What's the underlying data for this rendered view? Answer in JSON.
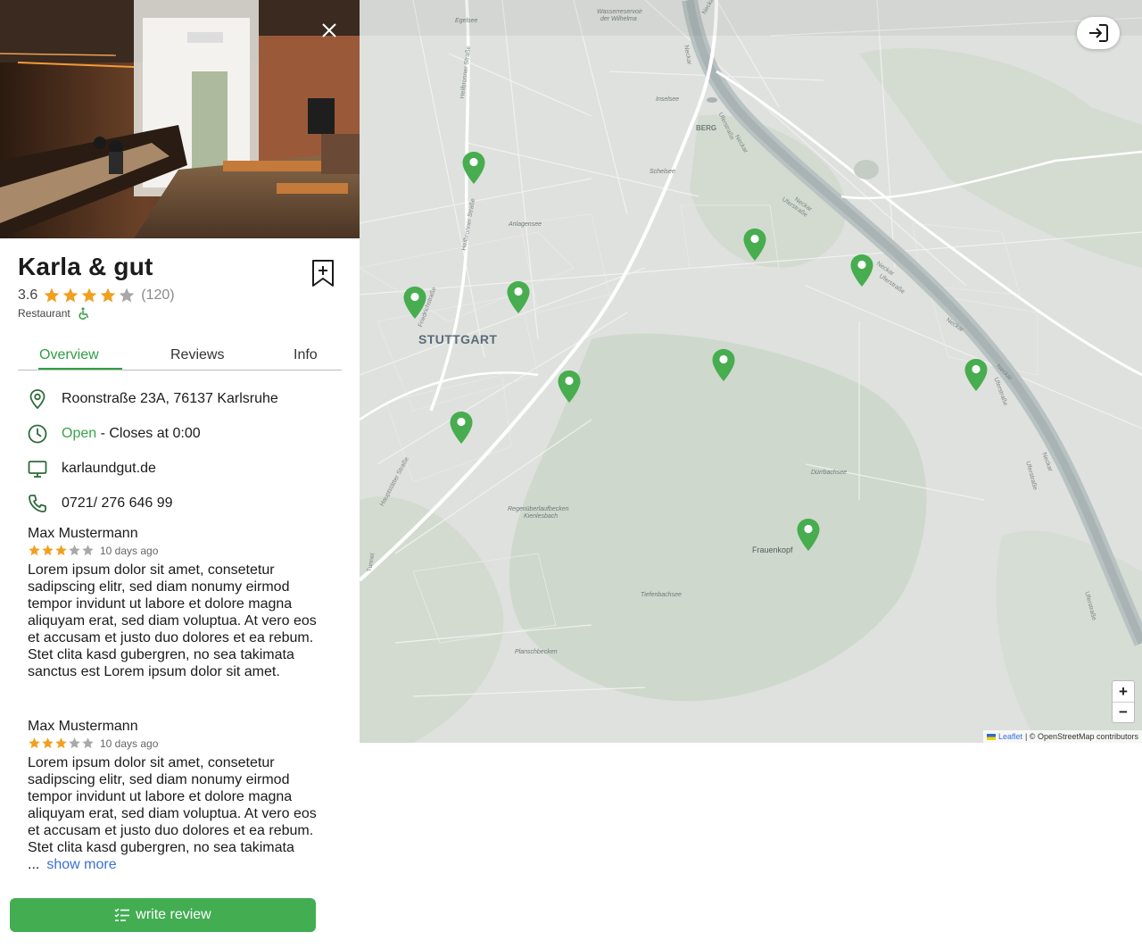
{
  "place": {
    "name": "Karla & gut",
    "rating": "3.6",
    "rating_stars": 3.6,
    "review_count": "(120)",
    "category": "Restaurant"
  },
  "tabs": [
    {
      "label": "Overview",
      "active": true
    },
    {
      "label": "Reviews",
      "active": false
    },
    {
      "label": "Info",
      "active": false
    }
  ],
  "info": {
    "address": "Roonstraße 23A, 76137 Karlsruhe",
    "open_status": "Open",
    "hours": " - Closes at 0:00",
    "website": "karlaundgut.de",
    "phone": "0721/ 276 646 99"
  },
  "reviews": [
    {
      "author": "Max Mustermann",
      "stars": 3,
      "date": "10 days ago",
      "text": "Lorem ipsum dolor sit amet, consetetur sadipscing elitr, sed diam nonumy eirmod tempor invidunt ut labore et dolore magna aliquyam erat, sed diam voluptua. At vero eos et accusam et justo duo dolores et ea rebum. Stet clita kasd gubergren, no sea takimata sanctus est Lorem ipsum dolor sit amet."
    },
    {
      "author": "Max Mustermann",
      "stars": 3,
      "date": "10 days ago",
      "text": "Lorem ipsum dolor sit amet, consetetur sadipscing elitr, sed diam nonumy eirmod tempor invidunt ut labore et dolore magna aliquyam erat, sed diam voluptua. At vero eos et accusam et justo duo dolores et ea rebum. Stet clita kasd gubergren, no sea takimata ...",
      "show_more": "show more"
    }
  ],
  "actions": {
    "write_review": "write review"
  },
  "map": {
    "city_label": "STUTTGART",
    "labels": {
      "berg": "BERG",
      "frauenkopf": "Frauenkopf",
      "egelsee": "Egelsee",
      "wasserreservoir": "Wasserreservoir",
      "wilhelma": "der Wilhelma",
      "inselsee": "Inselsee",
      "schelsee": "Schelsee",
      "anlagensee": "Anlagensee",
      "durrbachsee": "Dürrbachsee",
      "regenueberlauf": "Regenüberlaufbecken",
      "kienlesbach": "Kienlesbach",
      "tiefenbachsee": "Tiefenbachsee",
      "planschbecken": "Planschbecken",
      "heilbronner1": "Heilbronner Straße",
      "heilbronner2": "Heilbronner Straße",
      "friedrichstrasse": "Friedrichstraße",
      "hauptstaetter": "Hauptstätter Straße",
      "uferstrasse1": "Uferstraße",
      "uferstrasse2": "Uferstraße",
      "uferstrasse3": "Uferstraße",
      "uferstrasse4": "Uferstraße",
      "uferstrasse5": "Uferstraße",
      "uferstrasse6": "Uferstraße",
      "neckar1": "Neckar",
      "neckar2": "Neckar",
      "neckar3": "Neckar",
      "neckar4": "Neckar",
      "neckar5": "Neckar",
      "neckar6": "Neckar",
      "neckar7": "Neckar",
      "neckar8": "Neckar",
      "tunnel": "Tunnel"
    },
    "zoom_in": "+",
    "zoom_out": "−",
    "attribution_link": "Leaflet",
    "attribution_text": "| © OpenStreetMap contributors",
    "marker_color": "#4caf50"
  },
  "colors": {
    "accent": "#43ad52",
    "star": "#f0a020",
    "star_empty": "#a8a8a8",
    "link": "#3a6fd8"
  }
}
